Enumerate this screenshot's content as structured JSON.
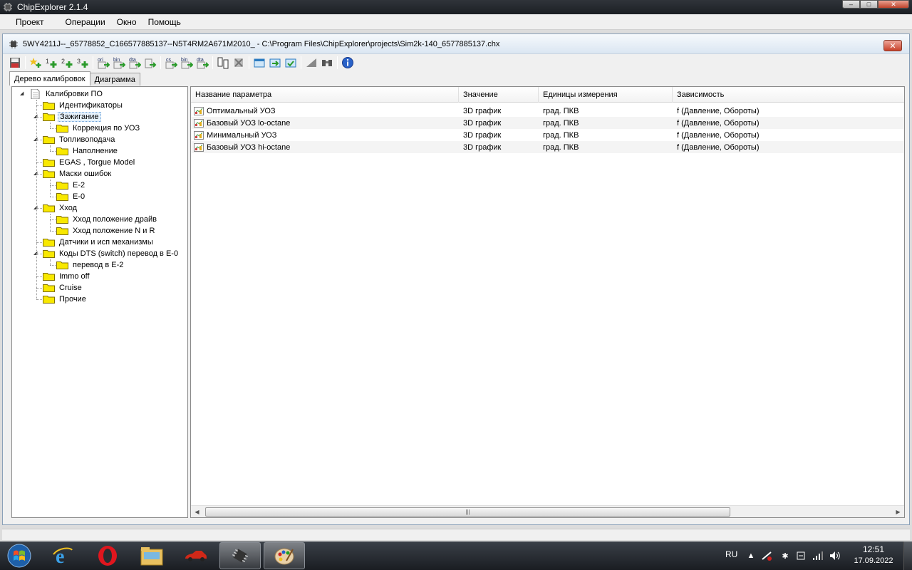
{
  "app": {
    "title": "ChipExplorer 2.1.4"
  },
  "menu": [
    "Проект",
    "Операции",
    "Окно",
    "Помощь"
  ],
  "child": {
    "title": "5WY4211J--_65778852_C166577885137--N5T4RM2A671M2010_ - C:\\Program Files\\ChipExplorer\\projects\\Sim2k-140_6577885137.chx"
  },
  "tabs": [
    "Дерево калибровок",
    "Диаграмма"
  ],
  "tree": [
    {
      "label": "Калибровки ПО",
      "level": 0,
      "expanded": true,
      "icon": "document"
    },
    {
      "label": "Идентификаторы",
      "level": 1
    },
    {
      "label": "Зажигание",
      "level": 1,
      "expanded": true,
      "selected": true
    },
    {
      "label": "Коррекция по УОЗ",
      "level": 2
    },
    {
      "label": "Топливоподача",
      "level": 1,
      "expanded": true
    },
    {
      "label": "Наполнение",
      "level": 2
    },
    {
      "label": "EGAS , Torgue Model",
      "level": 1
    },
    {
      "label": "Маски ошибок",
      "level": 1,
      "expanded": true
    },
    {
      "label": "E-2",
      "level": 2
    },
    {
      "label": "E-0",
      "level": 2
    },
    {
      "label": "Xход",
      "level": 1,
      "expanded": true
    },
    {
      "label": "Xход положение драйв",
      "level": 2
    },
    {
      "label": "Xход положение N и R",
      "level": 2
    },
    {
      "label": "Датчики и исп механизмы",
      "level": 1
    },
    {
      "label": "Коды DTS (switch) перевод в E-0",
      "level": 1,
      "expanded": true
    },
    {
      "label": "перевод в E-2",
      "level": 2
    },
    {
      "label": "Immo off",
      "level": 1
    },
    {
      "label": "Cruise",
      "level": 1
    },
    {
      "label": "Прочие",
      "level": 1
    }
  ],
  "grid": {
    "columns": [
      "Название параметра",
      "Значение",
      "Единицы измерения",
      "Зависимость"
    ],
    "rows": [
      [
        "Оптимальный  УОЗ",
        "3D график",
        "град. ПКВ",
        "f (Давление, Обороты)"
      ],
      [
        "Базовый УОЗ lo-octane",
        "3D график",
        "град. ПКВ",
        "f (Давление, Обороты)"
      ],
      [
        "Минимальный УОЗ",
        "3D график",
        "град. ПКВ",
        "f (Давление, Обороты)"
      ],
      [
        "Базовый УОЗ hi-octane",
        "3D график",
        "град. ПКВ",
        "f (Давление, Обороты)"
      ]
    ]
  },
  "tray": {
    "lang": "RU",
    "time": "12:51",
    "date": "17.09.2022"
  }
}
